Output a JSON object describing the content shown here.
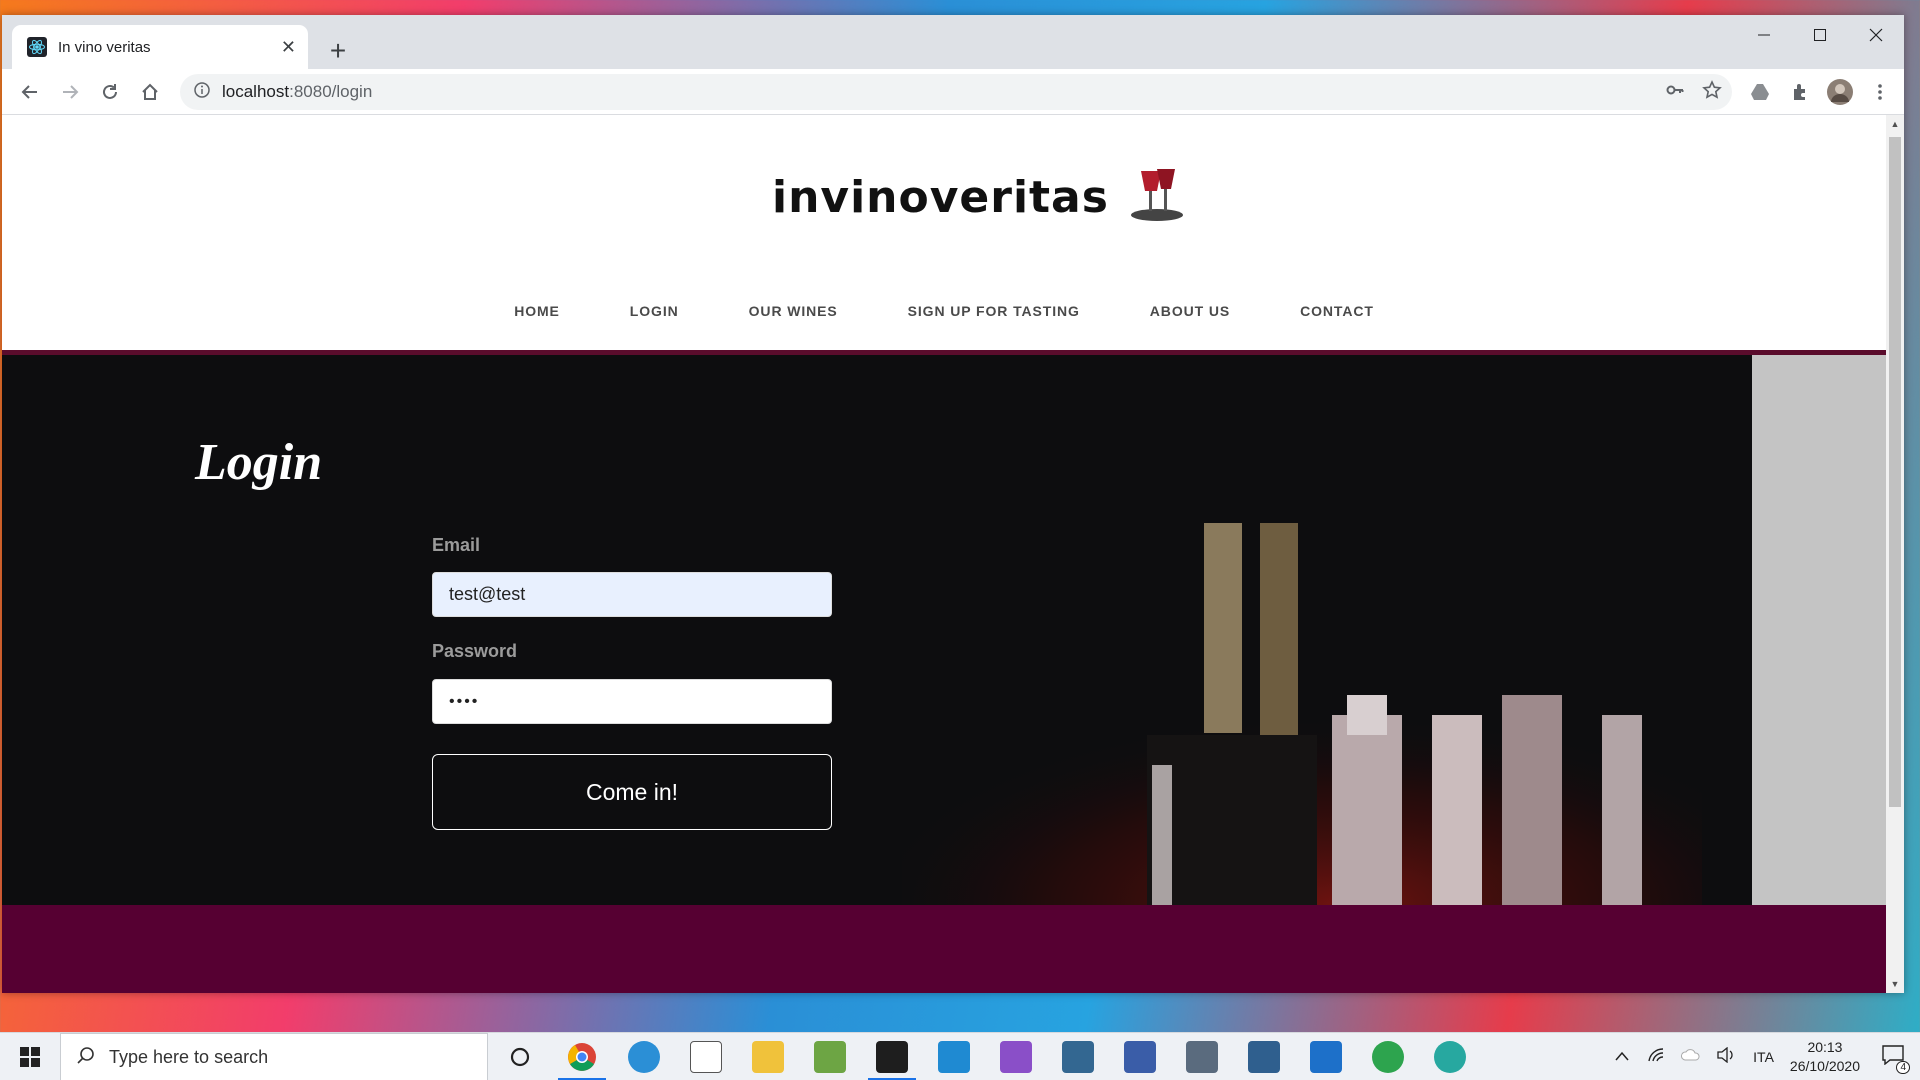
{
  "browser": {
    "tab_title": "In vino veritas",
    "url_host": "localhost",
    "url_rest": ":8080/login",
    "new_tab_label": "+",
    "close_tab_label": "✕",
    "window_controls": {
      "minimize": "—",
      "maximize": "☐",
      "close": "✕"
    }
  },
  "site": {
    "logo_text": "invinoveritas",
    "nav": [
      "HOME",
      "LOGIN",
      "OUR WINES",
      "SIGN UP FOR TASTING",
      "ABOUT US",
      "CONTACT"
    ],
    "login": {
      "title": "Login",
      "email_label": "Email",
      "email_value": "test@test",
      "password_label": "Password",
      "password_value": "••••",
      "submit_label": "Come in!"
    },
    "colors": {
      "nav_border": "#5a0c2c",
      "hero_bg": "#0d0d0f",
      "footer_bg": "#560032",
      "email_field_bg": "#e8f0fe"
    }
  },
  "taskbar": {
    "search_placeholder": "Type here to search",
    "apps": [
      "cortana-icon",
      "chrome-icon",
      "edge-icon",
      "notepad-icon",
      "file-explorer-icon",
      "minecraft-icon",
      "terminal-icon",
      "vscode-icon",
      "visual-studio-icon",
      "postgres-icon",
      "remote-desktop-icon",
      "calculator-icon",
      "ssms-icon",
      "window-app-icon",
      "maps-icon",
      "edge-dev-icon"
    ],
    "language": "ITA",
    "time": "20:13",
    "date": "26/10/2020",
    "notification_count": "4"
  }
}
